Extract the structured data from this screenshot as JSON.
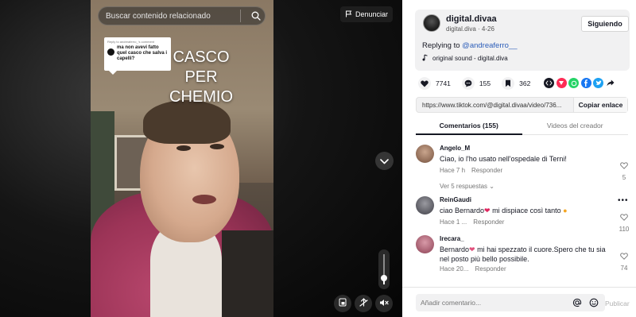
{
  "video": {
    "search_placeholder": "Buscar contenido relacionado",
    "report_label": "Denunciar",
    "overlay_title": "CASCO\nPER\nCHEMIO",
    "reply_bubble": {
      "header": "Reply to andreaferro_'s comment",
      "text": "ma non avevi fatto quel casco che salva i capelli?"
    },
    "volume_level": 0.2
  },
  "author": {
    "name": "digital.divaa",
    "meta": "digital.diva · 4-26",
    "follow_label": "Siguiendo",
    "caption_prefix": "Replying to ",
    "caption_mention": "@andreaferro__",
    "sound": "original sound - digital.diva"
  },
  "stats": {
    "likes": "7741",
    "comments": "155",
    "saves": "362"
  },
  "share": {
    "link": "https://www.tiktok.com/@digital.divaa/video/736...",
    "copy_label": "Copiar enlace",
    "colors": {
      "embed": "#161823",
      "pinterest": "#fe2c55",
      "whatsapp": "#25d366",
      "facebook": "#1877f2",
      "twitter": "#1da1f2"
    }
  },
  "tabs": [
    {
      "label": "Comentarios (155)"
    },
    {
      "label": "Videos del creador"
    }
  ],
  "comments": [
    {
      "user": "Angelo_M",
      "text": "Ciao, io l'ho usato nell'ospedale di Terni!",
      "time": "Hace 7 h",
      "reply": "Responder",
      "likes": "5",
      "replies": "Ver 5 respuestas"
    },
    {
      "user": "ReinGaudi",
      "text_a": "ciao Bernardo",
      "text_b": " mi dispiace così tanto",
      "time": "Hace 1 ...",
      "reply": "Responder",
      "likes": "110",
      "more": "•••"
    },
    {
      "user": "Irecara_",
      "text_a": "Bernardo",
      "text_b": " mi hai spezzato il cuore.Spero che tu sia nel posto più bello possibile.",
      "time": "Hace 20...",
      "reply": "Responder",
      "likes": "74"
    }
  ],
  "composer": {
    "placeholder": "Añadir comentario...",
    "post_label": "Publicar"
  },
  "colors": {
    "accent_mention": "#2b5db9",
    "heart": "#fe2c55"
  }
}
